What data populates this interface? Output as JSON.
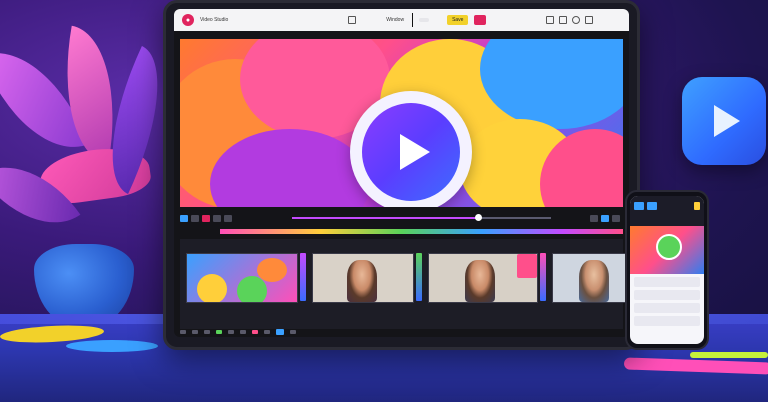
{
  "app": {
    "title": "Video Studio",
    "center_label": "Window",
    "export_label": "Save",
    "accent_color": "#e0245e"
  },
  "preview": {
    "play_icon": "play-icon"
  },
  "timeline": {
    "progress": 0.72
  },
  "phone": {
    "rows": [
      "",
      "",
      "",
      ""
    ]
  },
  "colors": {
    "background": "#2a1a6a",
    "desk": "#2d37b0",
    "pink": "#ff4fb8",
    "yellow": "#f2d12a",
    "blue": "#3aa0ff"
  }
}
